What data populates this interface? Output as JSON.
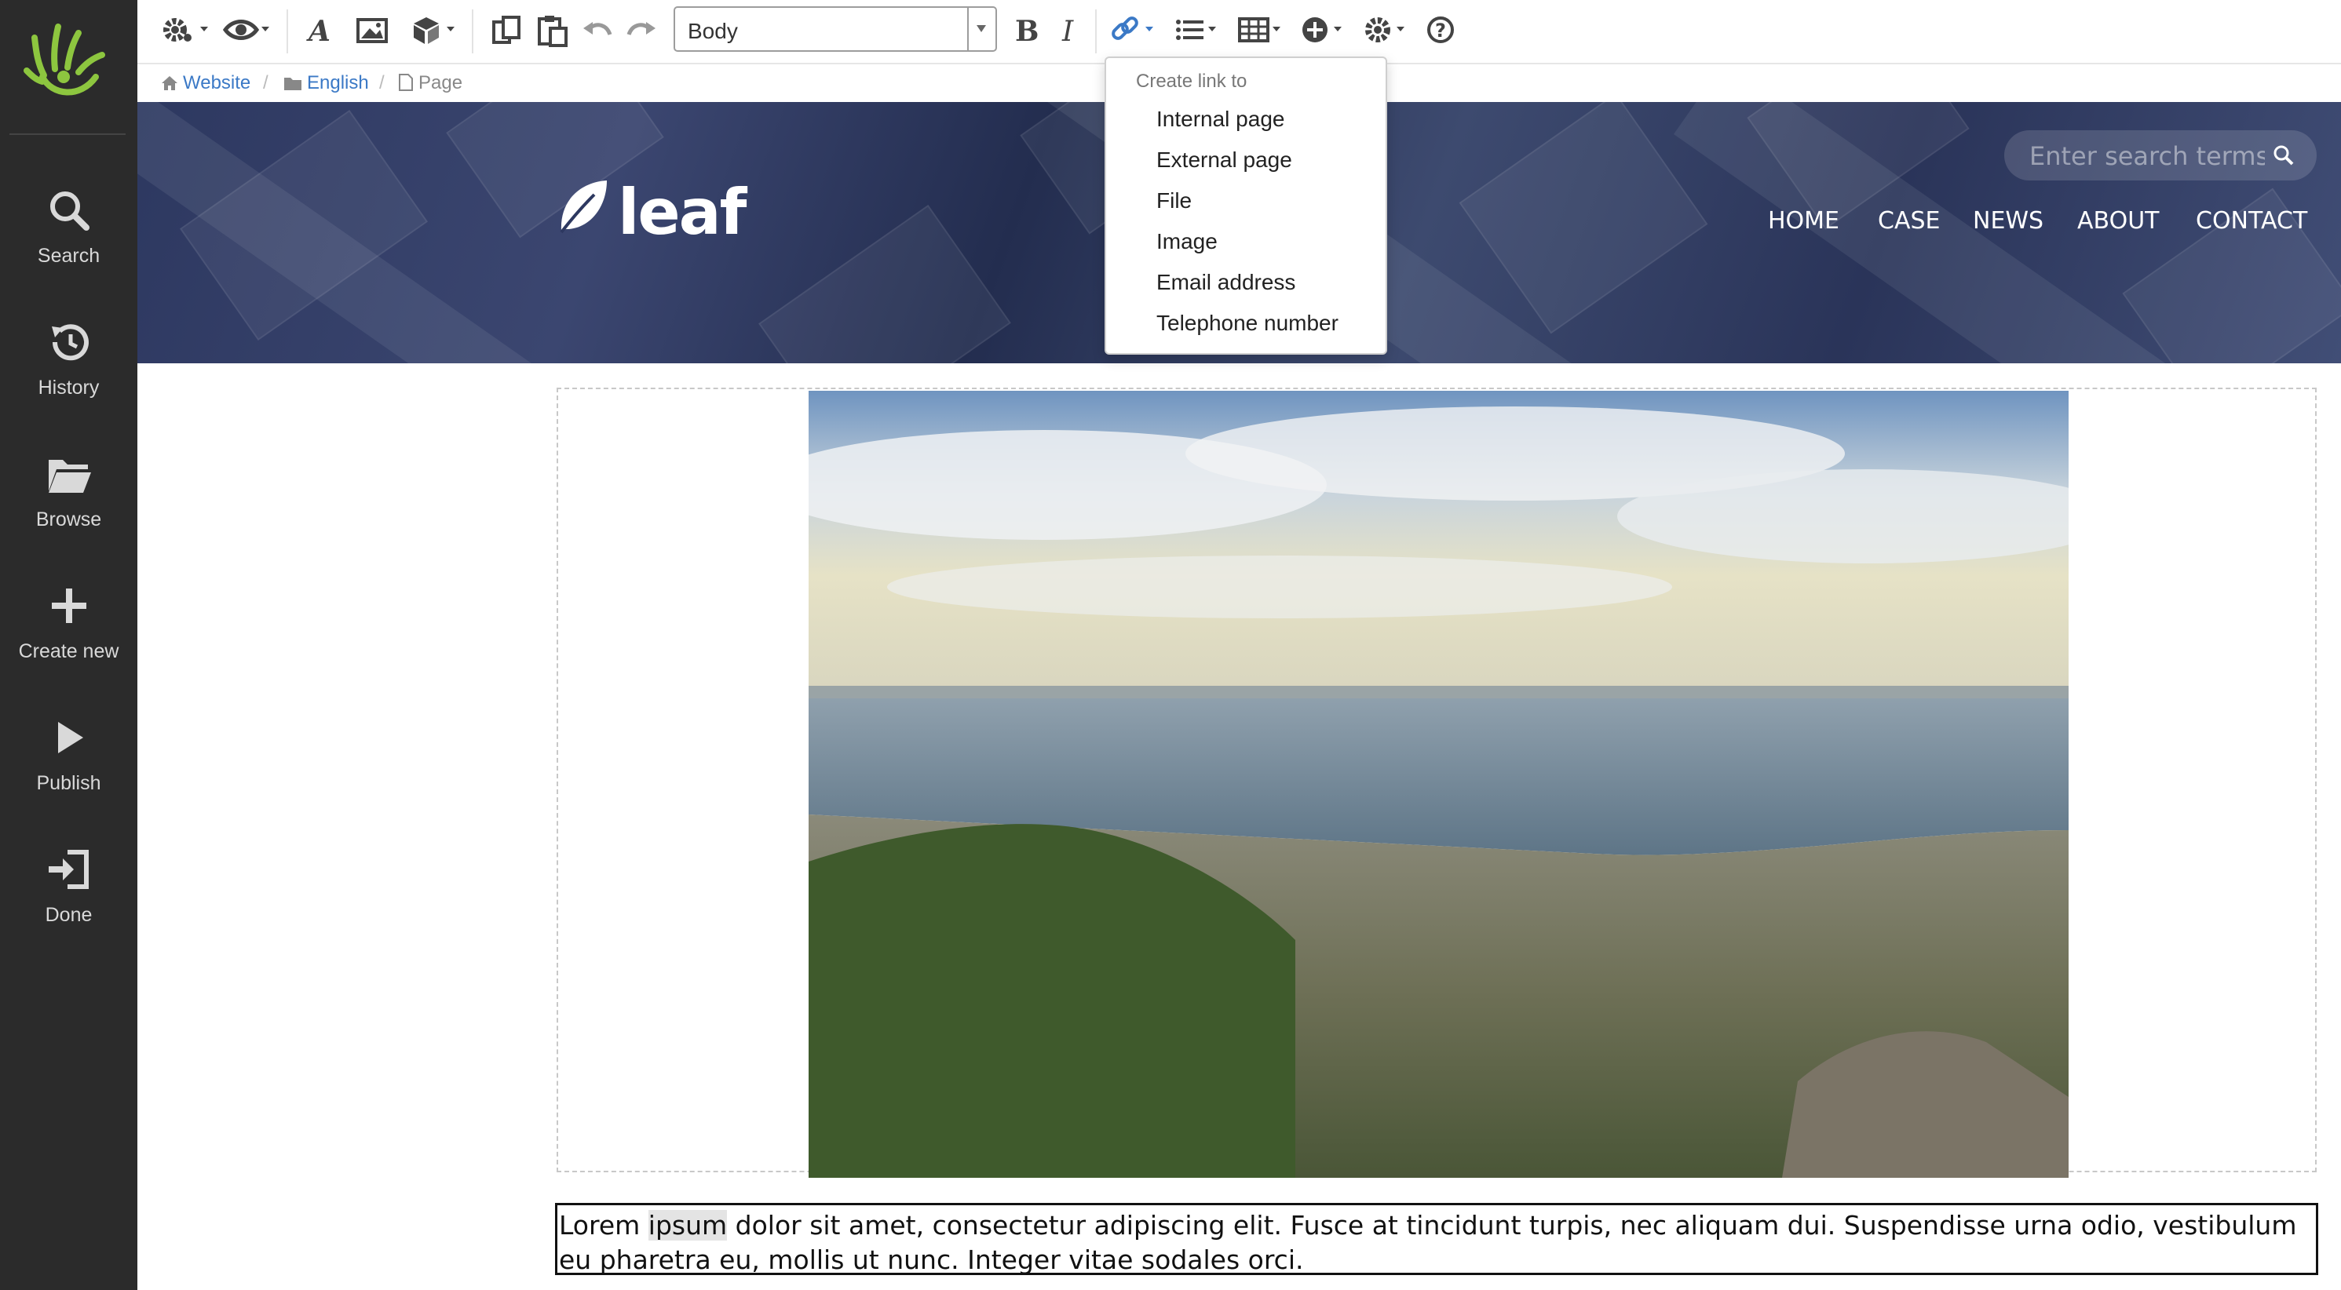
{
  "sidebar": {
    "items": [
      {
        "label": "Search",
        "icon": "search-icon"
      },
      {
        "label": "History",
        "icon": "history-icon"
      },
      {
        "label": "Browse",
        "icon": "folder-icon"
      },
      {
        "label": "Create new",
        "icon": "plus-icon"
      },
      {
        "label": "Publish",
        "icon": "play-icon"
      },
      {
        "label": "Done",
        "icon": "sign-out-icon"
      }
    ],
    "logo_icon": "hand-logo-icon",
    "logo_color": "#8dc63f"
  },
  "toolbar": {
    "style_value": "Body",
    "bold_label": "B",
    "italic_label": "I",
    "help_label": "?"
  },
  "breadcrumb": {
    "items": [
      "Website",
      "English",
      "Page"
    ],
    "separator": "/"
  },
  "link_menu": {
    "header": "Create link to",
    "items": [
      "Internal page",
      "External page",
      "File",
      "Image",
      "Email address",
      "Telephone number"
    ]
  },
  "site": {
    "logo_text": "leaf",
    "search_placeholder": "Enter search terms",
    "nav": [
      "HOME",
      "CASE",
      "NEWS",
      "ABOUT",
      "CONTACT"
    ]
  },
  "content": {
    "text_before": "Lorem ",
    "text_highlight": "ipsum",
    "text_after": " dolor sit amet, consectetur adipiscing elit. Fusce at tincidunt turpis, nec aliquam dui. Suspendisse urna odio, vestibulum eu pharetra eu, mollis ut nunc. Integer vitae sodales orci."
  },
  "colors": {
    "sidebar_bg": "#2b2b2b",
    "link_blue": "#3b79c6",
    "banner_navy": "#2d3860"
  }
}
